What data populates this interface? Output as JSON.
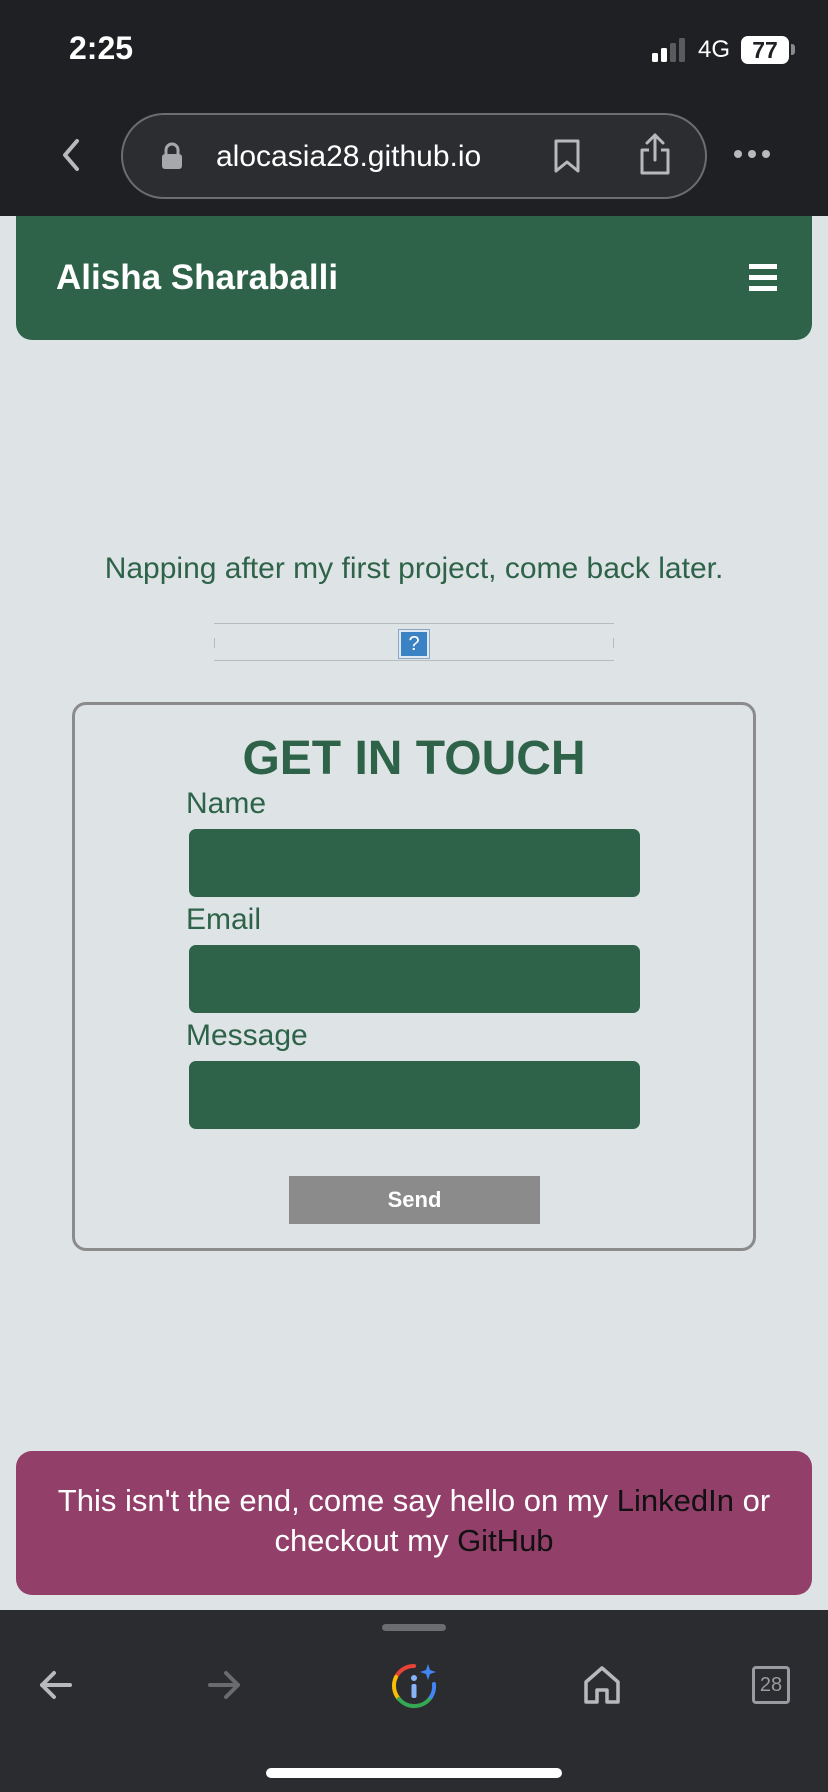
{
  "status_bar": {
    "time": "2:25",
    "network": "4G",
    "battery": "77"
  },
  "browser": {
    "url": "alocasia28.github.io",
    "tab_count": "28"
  },
  "header": {
    "title": "Alisha Sharaballi"
  },
  "main": {
    "message": "Napping after my first project, come back later.",
    "broken_image_glyph": "?"
  },
  "contact": {
    "title": "GET IN TOUCH",
    "name_label": "Name",
    "name_value": "",
    "email_label": "Email",
    "email_value": "",
    "message_label": "Message",
    "message_value": "",
    "send_label": "Send"
  },
  "footer": {
    "text_before": "This isn't the end, come say hello on my ",
    "linkedin": "LinkedIn",
    "text_middle": " or checkout my ",
    "github": "GitHub"
  },
  "colors": {
    "brand_green": "#2e6349",
    "footer_plum": "#923f6a",
    "page_background": "#dee3e6",
    "button_gray": "#8b8b8b"
  },
  "icons": [
    "back-chevron-icon",
    "lock-icon",
    "bookmark-icon",
    "share-icon",
    "more-icon",
    "menu-icon",
    "broken-image-icon",
    "arrow-left-icon",
    "arrow-right-icon",
    "google-lens-icon",
    "home-icon"
  ]
}
